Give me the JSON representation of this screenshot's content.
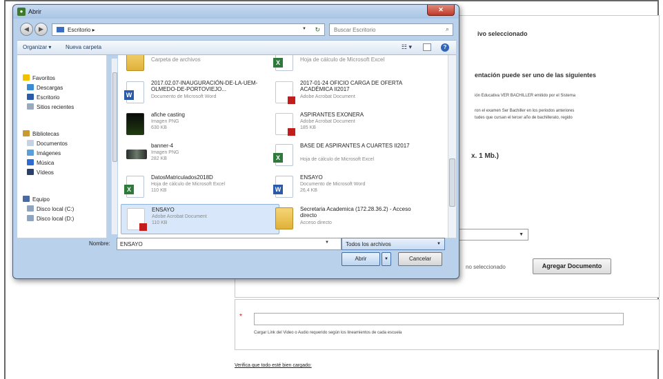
{
  "page": {
    "form_title": "ivo seleccionado",
    "form_heading": "entación puede ser uno de las siguientes",
    "form_lines": [
      "ión Educativa VER BACHILLER emitido por el Sistema",
      "ron el examen Ser Bachiller en los periodos anteriores",
      "tudes que cursan el tercer año de bachillerato, regido"
    ],
    "form_size_text": "x. 1 Mb.)",
    "select_arrow": "▼",
    "no_file_text": "no seleccionado",
    "agregar_label": "Agregar Documento",
    "required_mark": "*",
    "url_hint": "Cargar Link del Video o Audio requerido según los lineamientos de cada escuela",
    "verify_link": "Verifica que todo esté bien cargado:"
  },
  "dialog": {
    "title": "Abrir",
    "close_label": "✕",
    "address": {
      "back_glyph": "◀",
      "forward_glyph": "▶",
      "path": "Escritorio ▸",
      "refresh_glyph": "↻",
      "search_placeholder": "Buscar Escritorio"
    },
    "toolbar": {
      "organize": "Organizar ▾",
      "new_folder": "Nueva carpeta",
      "view_glyph": "☷ ▾",
      "help": "?"
    },
    "nav": [
      {
        "label": "Favoritos",
        "icon": "star-icon",
        "color": "#f2c200"
      },
      {
        "label": "Descargas",
        "icon": "downloads-icon",
        "color": "#3a8ad6"
      },
      {
        "label": "Escritorio",
        "icon": "desktop-icon",
        "color": "#2b5aa8"
      },
      {
        "label": "Sitios recientes",
        "icon": "recent-places-icon",
        "color": "#9ab"
      },
      {
        "label": "Bibliotecas",
        "icon": "libraries-icon",
        "color": "#c99a2e"
      },
      {
        "label": "Documentos",
        "icon": "documents-icon",
        "color": "#c4d2e6"
      },
      {
        "label": "Imágenes",
        "icon": "pictures-icon",
        "color": "#5aa0d8"
      },
      {
        "label": "Música",
        "icon": "music-icon",
        "color": "#2f6bd0"
      },
      {
        "label": "Vídeos",
        "icon": "videos-icon",
        "color": "#2b3f6e"
      },
      {
        "label": "Equipo",
        "icon": "computer-icon",
        "color": "#4a6aa0"
      },
      {
        "label": "Disco local (C:)",
        "icon": "drive-icon",
        "color": "#8fa4bf"
      },
      {
        "label": "Disco local (D:)",
        "icon": "drive-icon",
        "color": "#8fa4bf"
      }
    ],
    "files_left": [
      {
        "name": "Carpeta de archivos",
        "meta": [],
        "icon": "folder"
      },
      {
        "name": "2017.02.07-INAUGURACIÓN-DE-LA-UEM-OLMEDO-DE-PORTOVIEJO...",
        "meta": [
          "Documento de Microsoft Word"
        ],
        "icon": "word"
      },
      {
        "name": "afiche casting",
        "meta": [
          "Imagen PNG",
          "630 KB"
        ],
        "icon": "png"
      },
      {
        "name": "banner-4",
        "meta": [
          "Imagen PNG",
          "282 KB"
        ],
        "icon": "banner"
      },
      {
        "name": "DatosMatriculados2018D",
        "meta": [
          "Hoja de cálculo de Microsoft Excel",
          "110 KB"
        ],
        "icon": "excel"
      },
      {
        "name": "ENSAYO",
        "meta": [
          "Adobe Acrobat Document",
          "110 KB"
        ],
        "icon": "pdf",
        "selected": true
      }
    ],
    "files_right": [
      {
        "name": "Hoja de cálculo de Microsoft Excel",
        "meta": [],
        "icon": "excel"
      },
      {
        "name": "2017-01-24 OFICIO CARGA DE OFERTA ACADÉMICA II2017",
        "meta": [
          "Adobe Acrobat Document"
        ],
        "icon": "pdf"
      },
      {
        "name": "ASPIRANTES EXONERA",
        "meta": [
          "Adobe Acrobat Document",
          "185 KB"
        ],
        "icon": "pdf"
      },
      {
        "name": "BASE DE ASPIRANTES A CUARTES II2017",
        "meta": [
          "Hoja de cálculo de Microsoft Excel"
        ],
        "icon": "excel"
      },
      {
        "name": "ENSAYO",
        "meta": [
          "Documento de Microsoft Word",
          "26,4 KB"
        ],
        "icon": "word"
      },
      {
        "name": "Secretaria Academica (172.28.36.2) - Acceso directo",
        "meta": [
          "Acceso directo"
        ],
        "icon": "folder"
      }
    ],
    "filename_label": "Nombre:",
    "filename_value": "ENSAYO",
    "filetype_value": "Todos los archivos",
    "dropdown_glyph": "▼",
    "open_label": "Abrir",
    "cancel_label": "Cancelar"
  }
}
